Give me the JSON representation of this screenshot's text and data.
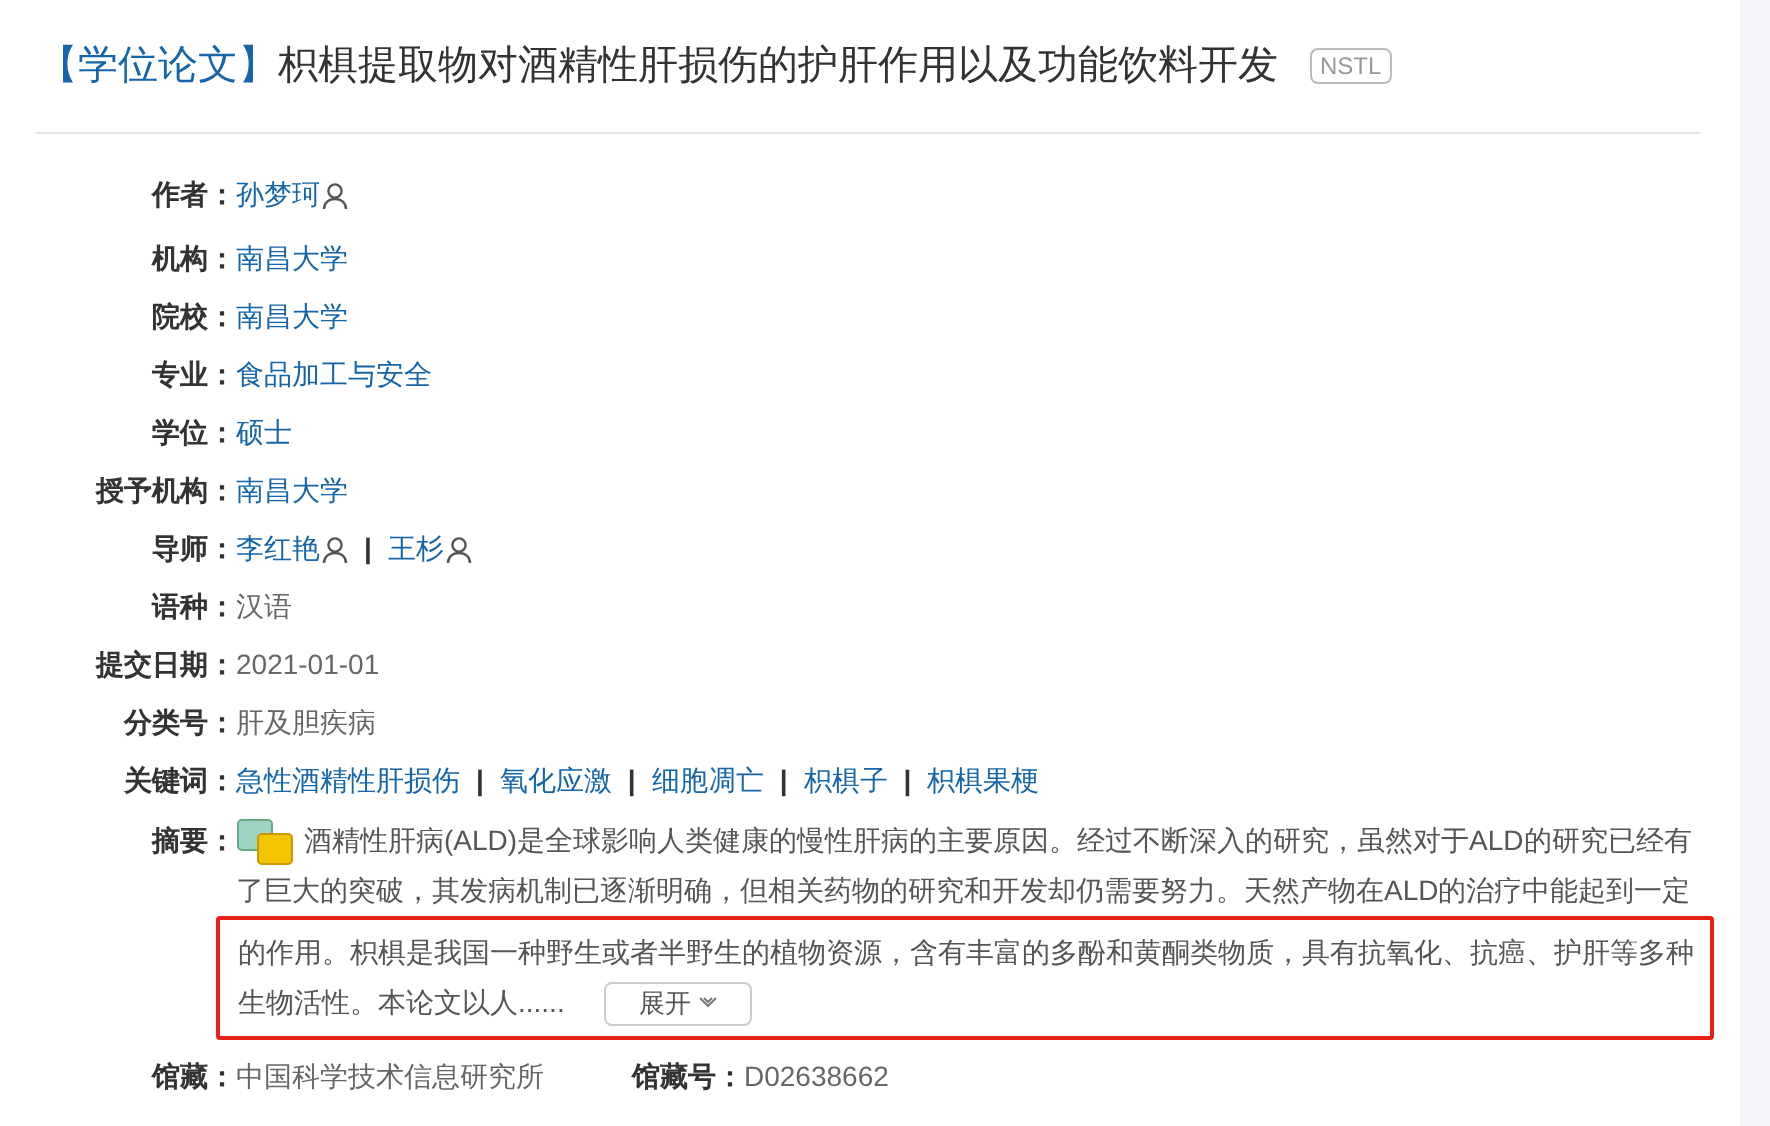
{
  "title": {
    "type_label": "【学位论文】",
    "text": "枳椇提取物对酒精性肝损伤的护肝作用以及功能饮料开发",
    "badge": "NSTL"
  },
  "fields": [
    {
      "label": "作者：",
      "kind": "person",
      "values": [
        {
          "text": "孙梦珂"
        }
      ]
    },
    {
      "label": "机构：",
      "kind": "link",
      "values": [
        {
          "text": "南昌大学"
        }
      ]
    },
    {
      "label": "院校：",
      "kind": "link",
      "values": [
        {
          "text": "南昌大学"
        }
      ]
    },
    {
      "label": "专业：",
      "kind": "link",
      "values": [
        {
          "text": "食品加工与安全"
        }
      ]
    },
    {
      "label": "学位：",
      "kind": "link",
      "values": [
        {
          "text": "硕士"
        }
      ]
    },
    {
      "label": "授予机构：",
      "kind": "link",
      "values": [
        {
          "text": "南昌大学"
        }
      ]
    },
    {
      "label": "导师：",
      "kind": "person",
      "values": [
        {
          "text": "李红艳",
          "separator": "|"
        },
        {
          "text": "王杉"
        }
      ]
    },
    {
      "label": "语种：",
      "kind": "plain",
      "values": [
        {
          "text": "汉语"
        }
      ]
    },
    {
      "label": "提交日期：",
      "kind": "plain",
      "values": [
        {
          "text": "2021-01-01"
        }
      ]
    },
    {
      "label": "分类号：",
      "kind": "plain",
      "values": [
        {
          "text": "肝及胆疾病"
        }
      ]
    },
    {
      "label": "关键词：",
      "kind": "link",
      "values": [
        {
          "text": "急性酒精性肝损伤",
          "separator": "|"
        },
        {
          "text": "氧化应激",
          "separator": "|"
        },
        {
          "text": "细胞凋亡",
          "separator": "|"
        },
        {
          "text": "枳椇子",
          "separator": "|"
        },
        {
          "text": "枳椇果梗"
        }
      ]
    }
  ],
  "abstract": {
    "label": "摘要：",
    "lines": [
      "酒精性肝病(ALD)是全球影响人类健康的慢性肝病的主要原因。经过不断深入的研究，虽然对于ALD的研究已经有",
      "了巨大的突破，其发病机制已逐渐明确，但相关药物的研究和开发却仍需要努力。天然产物在ALD的治疗中能起到一定"
    ],
    "highlight_box": {
      "lines": [
        "的作用。枳椇是我国一种野生或者半野生的植物资源，含有丰富的多酚和黄酮类物质，具有抗氧化、抗癌、护肝等多种",
        "生物活性。本论文以人......"
      ]
    },
    "expand_button": "展开"
  },
  "holdings": [
    {
      "label": "馆藏：",
      "value": "中国科学技术信息研究所"
    },
    {
      "label": "馆藏号：",
      "value": "D02638662"
    }
  ]
}
